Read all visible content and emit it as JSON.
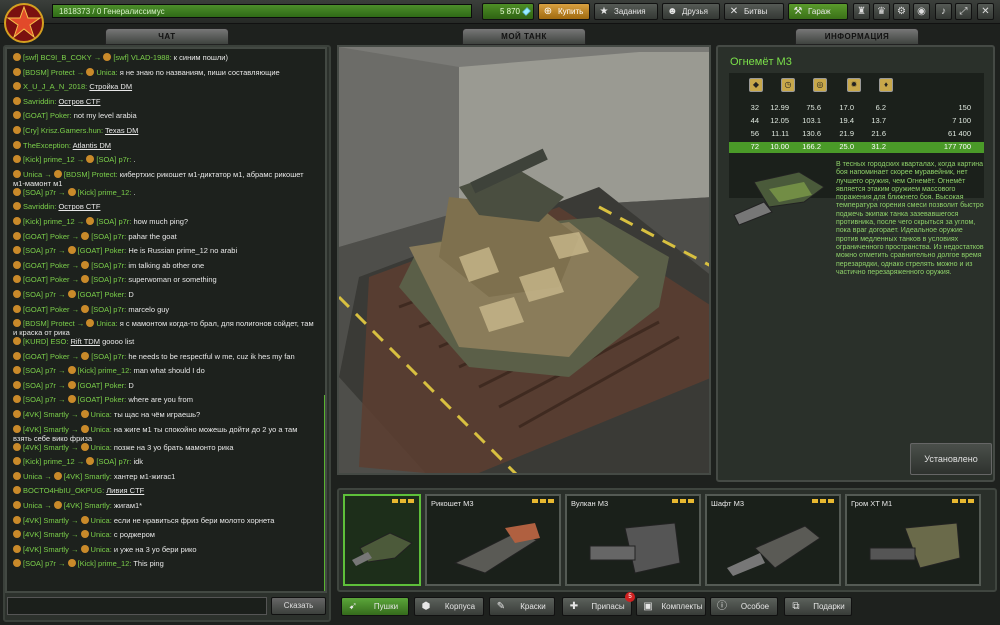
{
  "topbar": {
    "xp_text": "1818373 / 0 Генералиссимус",
    "crystals": "5 870",
    "buy": "Купить",
    "tasks": "Задания",
    "friends": "Друзья",
    "battles": "Битвы",
    "garage": "Гараж"
  },
  "chat": {
    "title": "ЧАТ",
    "send": "Сказать",
    "input_value": "",
    "messages": [
      {
        "from": "[swf] BC9I_B_COKY",
        "to": "[swf] VLAD-1988",
        "text": "к синим пошли)"
      },
      {
        "from": "[BDSM] Protect",
        "to": "Unica",
        "text": "я не знаю по названиям, пиши составляющие"
      },
      {
        "from": "X_U_J_A_N_2018",
        "link": "Стройка DM"
      },
      {
        "from": "Savriddin",
        "link": "Остров CTF"
      },
      {
        "from": "[GOAT] Poker",
        "text": "not my level arabia"
      },
      {
        "from": "[Cry] Krisz.Gamers.hun",
        "link": "Texas DM"
      },
      {
        "from": "TheException",
        "link": "Atlantis DM"
      },
      {
        "from": "[Kick] prime_12",
        "to": "[SOA] p7r",
        "text": "."
      },
      {
        "from": "Unica",
        "to": "[BDSM] Protect",
        "text": "кибертхис рикошет м1-диктатор м1, абрамс рикошет м1-мамонт м1"
      },
      {
        "from": "[SOA] p7r",
        "to": "[Kick] prime_12",
        "text": "."
      },
      {
        "from": "Savriddin",
        "link": "Остров CTF"
      },
      {
        "from": "[Kick] prime_12",
        "to": "[SOA] p7r",
        "text": "how much ping?"
      },
      {
        "from": "[GOAT] Poker",
        "to": "[SOA] p7r",
        "text": "pahar the goat"
      },
      {
        "from": "[SOA] p7r",
        "to": "[GOAT] Poker",
        "text": "He is Russian prime_12 no arabi"
      },
      {
        "from": "[GOAT] Poker",
        "to": "[SOA] p7r",
        "text": "im talking ab other one"
      },
      {
        "from": "[GOAT] Poker",
        "to": "[SOA] p7r",
        "text": "superwoman or something"
      },
      {
        "from": "[SOA] p7r",
        "to": "[GOAT] Poker",
        "text": "D"
      },
      {
        "from": "[GOAT] Poker",
        "to": "[SOA] p7r",
        "text": "marcelo guy"
      },
      {
        "from": "[BDSM] Protect",
        "to": "Unica",
        "text": "я с мамонтом когда-то брал, для полигонов сойдет, там и краска от рика"
      },
      {
        "from": "[KURD] ESO",
        "link": "Rift TDM",
        "after": "goooo list"
      },
      {
        "from": "[GOAT] Poker",
        "to": "[SOA] p7r",
        "text": "he needs to be respectful w me, cuz ik hes my fan"
      },
      {
        "from": "[SOA] p7r",
        "to": "[Kick] prime_12",
        "text": "man what should I do"
      },
      {
        "from": "[SOA] p7r",
        "to": "[GOAT] Poker",
        "text": "D"
      },
      {
        "from": "[SOA] p7r",
        "to": "[GOAT] Poker",
        "text": "where are you from"
      },
      {
        "from": "[4VK] Smartly",
        "to": "Unica",
        "text": "ты щас на чём играешь?"
      },
      {
        "from": "[4VK] Smartly",
        "to": "Unica",
        "text": "на жиге м1 ты спокойно можешь дойти до 2 уо а там взять себе вико фриза"
      },
      {
        "from": "[4VK] Smartly",
        "to": "Unica",
        "text": "позже на 3 уо брать мамонто рика"
      },
      {
        "from": "[Kick] prime_12",
        "to": "[SOA] p7r",
        "text": "idk"
      },
      {
        "from": "Unica",
        "to": "[4VK] Smartly",
        "text": "хантер м1-жигас1"
      },
      {
        "from": "BOCTO4HbIU_OKPUG",
        "link": "Ливия CTF"
      },
      {
        "from": "Unica",
        "to": "[4VK] Smartly",
        "text": "жигам1*"
      },
      {
        "from": "[4VK] Smartly",
        "to": "Unica",
        "text": "если не нравиться фриз бери молото хорнета"
      },
      {
        "from": "[4VK] Smartly",
        "to": "Unica",
        "text": "с роджером"
      },
      {
        "from": "[4VK] Smartly",
        "to": "Unica",
        "text": "и уже на 3 уо бери рико"
      },
      {
        "from": "[SOA] p7r",
        "to": "[Kick] prime_12",
        "text": "This ping"
      }
    ]
  },
  "tank": {
    "title": "МОЙ ТАНК"
  },
  "info": {
    "title": "ИНФОРМАЦИЯ",
    "item_name": "Огнемёт М3",
    "rows": [
      {
        "a": "32",
        "b": "12.99",
        "c": "75.6",
        "d": "17.0",
        "e": "6.2",
        "price": "150"
      },
      {
        "a": "44",
        "b": "12.05",
        "c": "103.1",
        "d": "19.4",
        "e": "13.7",
        "price": "7 100"
      },
      {
        "a": "56",
        "b": "11.11",
        "c": "130.6",
        "d": "21.9",
        "e": "21.6",
        "price": "61 400"
      },
      {
        "a": "72",
        "b": "10.00",
        "c": "166.2",
        "d": "25.0",
        "e": "31.2",
        "price": "177 700"
      }
    ],
    "selected_row": 3,
    "description": "В тесных городских кварталах, когда картина боя напоминает скорее муравейник, нет лучшего оружия, чем Огнемёт. Огнемёт является этаким оружием массового поражения для ближнего боя. Высокая температура горения смеси позволит быстро поджечь экипаж танка зазевавшегося противника, после чего скрыться за углом, пока враг догорает. Идеальное оружие против медленных танков в условиях ограниченного пространства. Из недостатков можно отметить сравнительно долгое время перезарядки, однако стрелять можно и из частично перезаряженного оружия.",
    "installed": "Установлено"
  },
  "items": [
    {
      "name": ""
    },
    {
      "name": "Рикошет М3"
    },
    {
      "name": "Вулкан М3"
    },
    {
      "name": "Шафт М3"
    },
    {
      "name": "Гром XT М1"
    }
  ],
  "bottom": {
    "guns": "Пушки",
    "hulls": "Корпуса",
    "paints": "Краски",
    "supplies": "Припасы",
    "kits": "Комплекты",
    "special": "Особое",
    "gifts": "Подарки",
    "supplies_badge": "5"
  }
}
